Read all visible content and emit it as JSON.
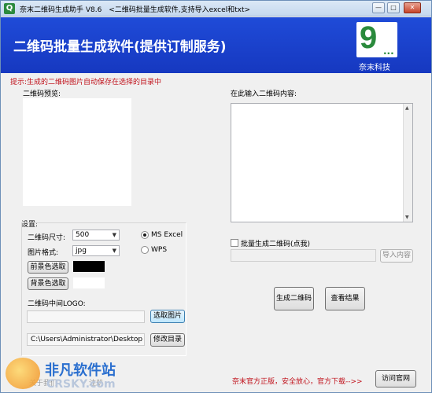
{
  "titlebar": {
    "app_title": "奈末二维码生成助手 V8.6",
    "subtitle": "<二维码批量生成软件,支持导入excel和txt>",
    "icon_glyph": "Q"
  },
  "banner": {
    "title": "二维码批量生成软件(提供订制服务)",
    "logo_text": "9",
    "logo_dots": "...",
    "company": "奈末科技"
  },
  "hint": "提示:生成的二维码图片自动保存在选择的目录中",
  "preview": {
    "label": "二维码预览:"
  },
  "content": {
    "label": "在此输入二维码内容:",
    "value": ""
  },
  "settings": {
    "label": "设置:",
    "size_label": "二维码尺寸:",
    "size_value": "500",
    "format_label": "图片格式:",
    "format_value": "jpg",
    "radio_excel": "MS  Excel",
    "radio_wps": "WPS",
    "fg_button": "前景色选取",
    "bg_button": "背景色选取",
    "fg_color": "#000000",
    "bg_color": "#ffffff",
    "logo_label": "二维码中间LOGO:",
    "logo_path": "",
    "choose_image_button": "选取图片",
    "output_path": "C:\\Users\\Administrator\\Desktop",
    "change_dir_button": "修改目录"
  },
  "batch": {
    "checkbox_label": "批量生成二维码(点我)",
    "import_path": "",
    "import_button": "导入内容"
  },
  "actions": {
    "generate_button": "生成二维码",
    "view_button": "查看结果"
  },
  "footer": {
    "note": "奈末官方正版，安全放心，官方下载-->>",
    "visit_button": "访问官网",
    "faint_left_1": "关于我们",
    "faint_left_2": "注册"
  },
  "watermark": {
    "text": "非凡软件站",
    "sub": "CRSKY.com"
  }
}
